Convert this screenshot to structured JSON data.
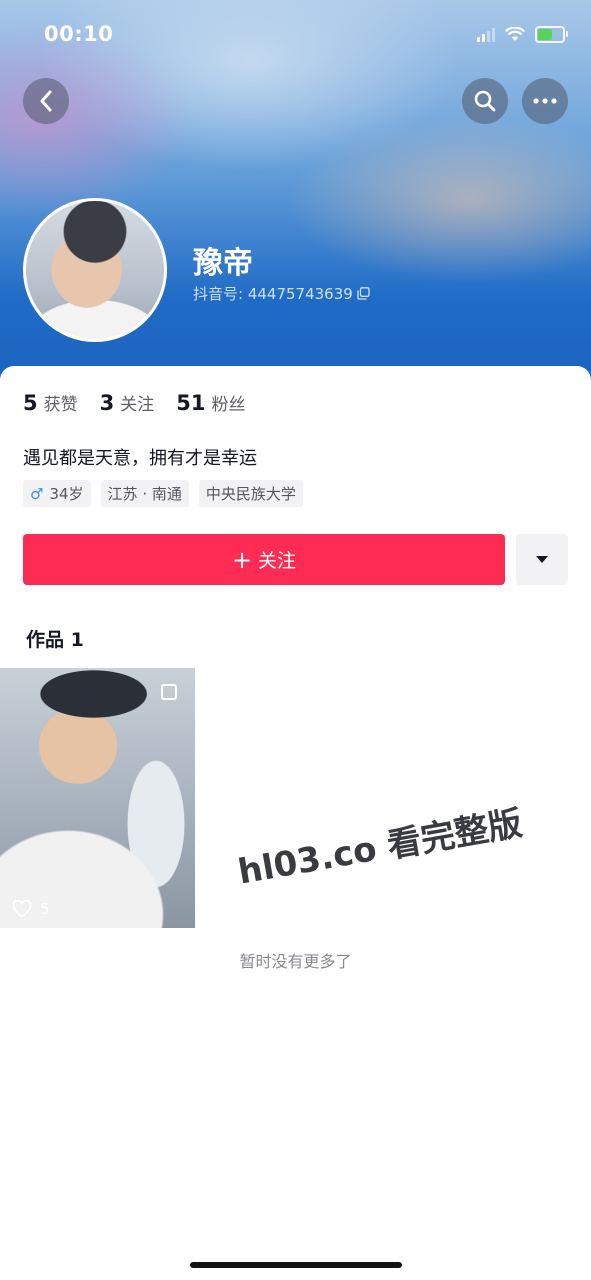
{
  "status_bar": {
    "time": "00:10"
  },
  "header": {
    "icons": [
      "back-icon",
      "search-icon",
      "more-icon"
    ]
  },
  "profile": {
    "name": "豫帝",
    "douyin_id": "抖音号: 44475743639"
  },
  "stats": [
    {
      "num": "5",
      "label": "获赞"
    },
    {
      "num": "3",
      "label": "关注"
    },
    {
      "num": "51",
      "label": "粉丝"
    }
  ],
  "bio": "遇见都是天意，拥有才是幸运",
  "tags": {
    "gender_symbol": "♂",
    "age": "34岁",
    "location": "江苏 · 南通",
    "school": "中央民族大学"
  },
  "actions": {
    "follow_label": "关注",
    "follow_plus": "+"
  },
  "works": {
    "title": "作品 1",
    "items": [
      {
        "likes": "5"
      }
    ],
    "end_text": "暂时没有更多了"
  },
  "watermark": "hl03.co 看完整版",
  "colors": {
    "accent": "#fe2c55",
    "header_blue": "#1f6bc6"
  }
}
